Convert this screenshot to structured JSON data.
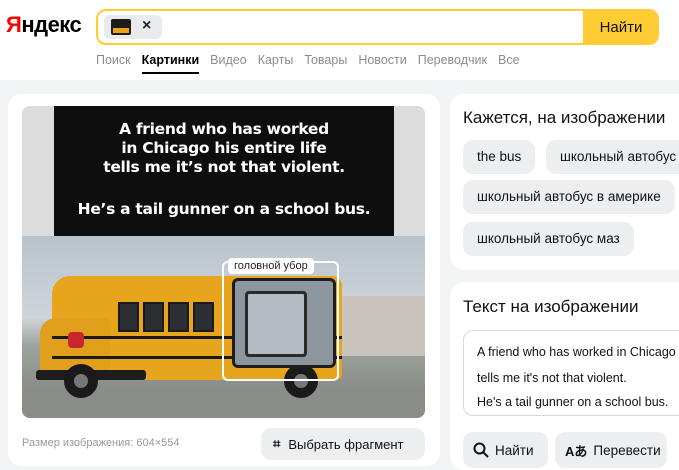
{
  "header": {
    "logo_first": "Я",
    "logo_rest": "ндекс",
    "search_button": "Найти",
    "close_symbol": "×"
  },
  "tabs": [
    {
      "label": "Поиск",
      "active": false
    },
    {
      "label": "Картинки",
      "active": true
    },
    {
      "label": "Видео",
      "active": false
    },
    {
      "label": "Карты",
      "active": false
    },
    {
      "label": "Товары",
      "active": false
    },
    {
      "label": "Новости",
      "active": false
    },
    {
      "label": "Переводчик",
      "active": false
    },
    {
      "label": "Все",
      "active": false
    }
  ],
  "image": {
    "meme_lines": [
      "A friend who has worked",
      "in Chicago his entire life",
      "tells me it’s not that violent.",
      "He’s a tail gunner on a school bus."
    ],
    "detected_object_label": "головной убор",
    "size_text": "Размер изображения: 604×554",
    "select_fragment_label": "Выбрать фрагмент"
  },
  "looks_like": {
    "title": "Кажется, на изображении",
    "chips": [
      "the bus",
      "школьный автобус",
      "школьный автобус в америке",
      "школьный автобус маз"
    ]
  },
  "ocr": {
    "title": "Текст на изображении",
    "lines": [
      "A friend who has worked in Chicago",
      "tells me it's not that violent.",
      "He's a tail gunner on a school bus."
    ],
    "find_label": "Найти",
    "translate_label": "Перевести"
  },
  "colors": {
    "accent_yellow": "#ffcc33",
    "logo_red": "#ff0000",
    "bus_yellow": "#e7a51e"
  }
}
